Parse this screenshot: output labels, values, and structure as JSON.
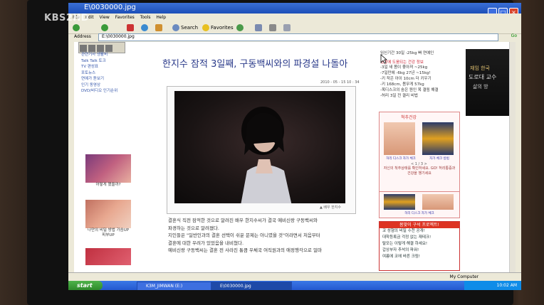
{
  "broadcaster_logo": "KBS2HD",
  "window": {
    "title": "E\\0030000.jpg",
    "menu": [
      "File",
      "Edit",
      "View",
      "Favorites",
      "Tools",
      "Help"
    ],
    "toolbar": {
      "search": "Search",
      "favorites": "Favorites"
    },
    "address_label": "Address",
    "address": "E:\\0030000.jpg",
    "go": "Go"
  },
  "left_nav": {
    "items": [
      "관련기사 생활비",
      "Talk Talk 토크",
      "TV 편성표",
      "포토뉴스",
      "연예가 돋보기",
      "인기 동영상",
      "DVD/비디오 인기순위"
    ],
    "thumb1_caption": "어떻게 했을까?",
    "thumb2_caption": "나만의 비밀 방법 가슴UP 피부UP"
  },
  "article": {
    "headline": "한지수 잠적 3일째, 구동백씨와의 파경설 나돌아",
    "dateline": "2010 - 05 - 15  10 : 34",
    "photo_caption": "▲ 배우 한지수",
    "body": [
      "결혼식 직전 잠적한 것으로 알려진 배우 한지수씨가 결국 예비신랑 구동백씨와",
      "파경하는 것으로 알려졌다.",
      "지인들은 \"일반인과의 결혼 선택이 쉬운 문제는 아니였을 것\"이라면서 처음부터",
      "결혼에 대한 우려가 있었음을 내비쳤다.",
      "예비신랑 구동백씨는 결혼 전 사라진 통큼 우체국 여직원과의 애정행각으로 얼마"
    ]
  },
  "right_col": {
    "top_line": "임신기간 30일 -25kg 빠 연예인",
    "section_title": "생활에 도움되는 건강 정보",
    "items": [
      "-3일 새 몸이 좋아져 ~25kg",
      "-7일만에 -6kg 27년 ~15kg!",
      "-키 작은 아이 10cm 더 키우기",
      "-키 168cm, 몸무게 57kg",
      "-목디스크의 숨은 원인 목 결림 해결",
      "-허리 3일 전 결리 비법"
    ],
    "health_header": "척추건강",
    "health_label_left": "허리 디스크 자가 체크",
    "health_label_right": "자가 체크 방법",
    "health_page": "< 1 / 3 >",
    "health_text": "자신의 척추상태를 확인하세요. GO! 허리통증과 건강을 챙기세요",
    "health_label_bottom": "허리 디스크 자가 체크"
  },
  "promo": {
    "header": "봄맞이 구석 프로젝트!",
    "items": [
      "코 성형의 비밀 수천 공개!",
      "대학등록금 걱정 없는 재테크!",
      "탈모는 이렇게 해결 하세요!",
      "갑상부자 추석의 파워!",
      "여름에 코에 바른 크림!"
    ]
  },
  "ad": {
    "line1": "재임 한국",
    "line2": "도로대 교수",
    "line3": "삶의 방"
  },
  "status": {
    "zone": "My Computer"
  },
  "taskbar": {
    "start": "start",
    "task1": "K3M_JIMWAN (E:)",
    "task2": "E\\0030000.jpg",
    "clock": "10:02 AM"
  }
}
